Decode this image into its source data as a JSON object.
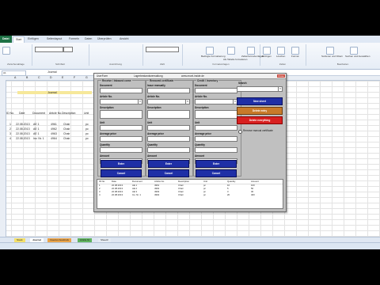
{
  "ribbon": {
    "tabs": [
      "Datei",
      "Start",
      "Einfügen",
      "Seitenlayout",
      "Formeln",
      "Daten",
      "Überprüfen",
      "Ansicht"
    ],
    "groups": [
      "Zwischenablage",
      "Schriftart",
      "Ausrichtung",
      "Zahl",
      "Formatvorlagen",
      "Zellen",
      "Bearbeiten"
    ],
    "buttons": [
      "Bedingte Formatierung",
      "Als Tabelle formatieren",
      "Zellenformatvorlagen",
      "Einfügen",
      "Löschen",
      "Format",
      "Sortieren und Filtern",
      "Suchen und Auswählen"
    ]
  },
  "formula_bar": {
    "name_box": "A1",
    "value": "Journal"
  },
  "sheet": {
    "columns": [
      "A",
      "B",
      "C",
      "D",
      "E",
      "F",
      "G",
      "H",
      "I",
      "J",
      "K",
      "L",
      "M",
      "N",
      "O",
      "P",
      "Q",
      "R",
      "S",
      "T",
      "U",
      "V",
      "W",
      "X",
      "Y",
      "Z",
      "AA",
      "AB",
      "AC",
      "AD",
      "AE"
    ],
    "title": "Journal",
    "headers": [
      "ID No.",
      "Date",
      "Document",
      "Article No.",
      "Description",
      "Unit"
    ],
    "rows": [
      [
        "1",
        "22.08.2013",
        "AE 1",
        "4961",
        "Chair",
        "pc"
      ],
      [
        "2",
        "22.08.2013",
        "AE 1",
        "4962",
        "Chair",
        "pc"
      ],
      [
        "3",
        "22.08.2013",
        "AE 1",
        "4963",
        "Chair",
        "pc"
      ],
      [
        "4",
        "22.08.2013",
        "Inv. Nr. 1",
        "4964",
        "Chair",
        "pc"
      ]
    ],
    "tabs": [
      "Stock",
      "Journal",
      "Inventur Ausdruck",
      "Article Nr",
      "Sheet3"
    ]
  },
  "form": {
    "title_left": "UserForm",
    "title_mid": "Lagerbestandsverwaltung",
    "title_right": "www.excel-inside.de",
    "close": "Close",
    "sections": [
      {
        "title": "Receive / Inbound come",
        "document": "Document",
        "article": "Article No.",
        "description": "Description",
        "unit": "Unit",
        "avg_price": "Average price",
        "quantity": "Quantity",
        "amount": "Amount",
        "enter": "Enter",
        "cancel": "Cancel"
      },
      {
        "title": "Removed certificate",
        "document": "Issue manually",
        "article": "Article No.",
        "description": "Description",
        "unit": "Unit",
        "avg_price": "Average price",
        "quantity": "Quantity",
        "amount": "Amount",
        "enter": "Enter",
        "cancel": "Cancel"
      },
      {
        "title": "Credit / Inventory",
        "document": "Document",
        "article": "Article No.",
        "description": "Description",
        "unit": "Unit",
        "avg_price": "Average price",
        "quantity": "Quantity",
        "amount": "Amount",
        "enter": "Enter",
        "cancel": "Cancel"
      }
    ],
    "search_label": "Search",
    "new_sheet": "New sheet",
    "delete_entry": "Delete entry",
    "delete_everything": "Delete everything",
    "radio_label": "Remove manual certificate",
    "list_headers": [
      "ID No.",
      "Date",
      "Document",
      "Article No.",
      "Description",
      "Unit",
      "Quantity",
      "Amount"
    ],
    "list_rows": [
      [
        "1",
        "22.08.2013",
        "AE 1",
        "4961",
        "Chair",
        "pc",
        "10",
        "100"
      ],
      [
        "2",
        "22.08.2013",
        "AE 2",
        "4962",
        "Chair",
        "pc",
        "5",
        "50"
      ],
      [
        "3",
        "22.08.2013",
        "AE 3",
        "4963",
        "Chair",
        "pc",
        "3",
        "30"
      ],
      [
        "4",
        "22.08.2013",
        "Inv. Nr. 1",
        "4964",
        "Chair",
        "pc",
        "20",
        "400"
      ]
    ]
  }
}
